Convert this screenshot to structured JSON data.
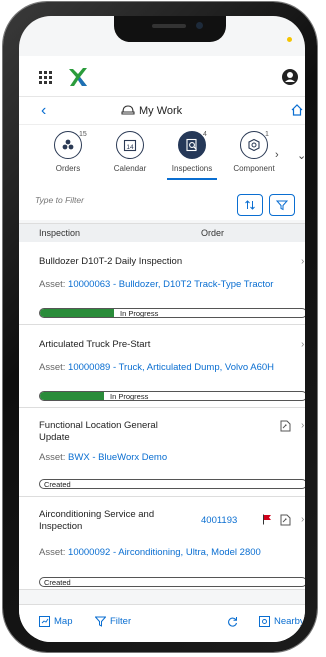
{
  "header": {
    "title": "My Work"
  },
  "tabs": [
    {
      "label": "Orders",
      "badge": "15",
      "icon": "cube-cluster-icon"
    },
    {
      "label": "Calendar",
      "badge": "",
      "icon": "calendar-icon",
      "day": "14"
    },
    {
      "label": "Inspections",
      "badge": "4",
      "icon": "inspection-icon",
      "active": true
    },
    {
      "label": "Component",
      "badge": "1",
      "icon": "component-icon"
    }
  ],
  "filter": {
    "placeholder": "Type to Filter"
  },
  "columns": {
    "inspection": "Inspection",
    "order": "Order"
  },
  "items": [
    {
      "title": "Bulldozer D10T-2 Daily Inspection",
      "asset_label": "Asset:",
      "asset_link": "10000063 - Bulldozer, D10T2 Track-Type Tractor",
      "status": "In Progress",
      "progress": 0.28
    },
    {
      "title": "Articulated Truck Pre-Start",
      "asset_label": "Asset:",
      "asset_link": "10000089 - Truck, Articulated Dump, Volvo A60H",
      "status": "In Progress",
      "progress": 0.24
    },
    {
      "title_line1": "Functional Location General",
      "title_line2": "Update",
      "asset_label": "Asset:",
      "asset_link": "BWX - BlueWorx Demo",
      "status": "Created"
    },
    {
      "title_line1": "Airconditioning Service and",
      "title_line2": "Inspection",
      "order": "4001193",
      "asset_label": "Asset:",
      "asset_link": "10000092 - Airconditioning, Ultra, Model 2800",
      "status": "Created"
    }
  ],
  "bottom": {
    "map": "Map",
    "filter": "Filter",
    "nearby": "Nearby"
  },
  "colors": {
    "accent": "#0a6ed1",
    "progress": "#2a8c3a",
    "flag": "#d0021b",
    "logo": "#2b9c3c"
  }
}
